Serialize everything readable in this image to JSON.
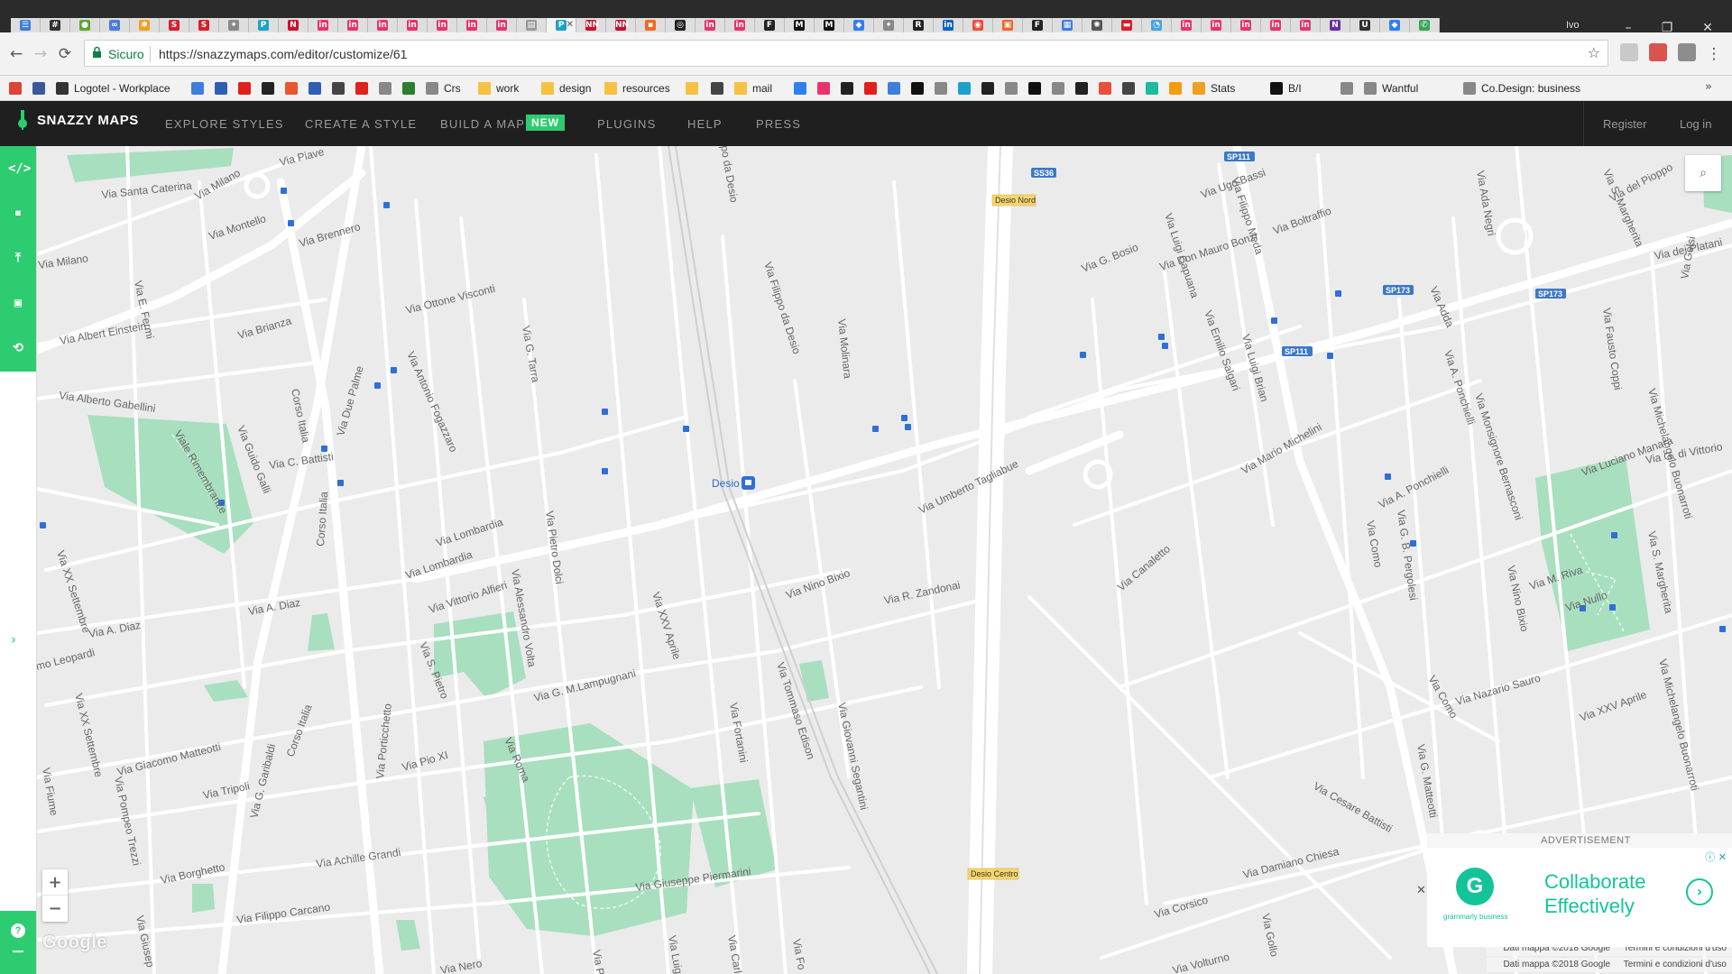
{
  "browser": {
    "tabs": [
      {
        "color": "#3d7fdb",
        "glyph": "☰"
      },
      {
        "color": "#333333",
        "glyph": "#"
      },
      {
        "color": "#5fa832",
        "glyph": "●"
      },
      {
        "color": "#4a7bd8",
        "glyph": "∞"
      },
      {
        "color": "#f0a020",
        "glyph": "✱"
      },
      {
        "color": "#d81e2b",
        "glyph": "S"
      },
      {
        "color": "#d81e2b",
        "glyph": "S"
      },
      {
        "color": "#888888",
        "glyph": "✦"
      },
      {
        "color": "#1ca2c9",
        "glyph": "P"
      },
      {
        "color": "#c8102e",
        "glyph": "N"
      },
      {
        "color": "#e8336d",
        "glyph": "in"
      },
      {
        "color": "#e8336d",
        "glyph": "in"
      },
      {
        "color": "#e8336d",
        "glyph": "in"
      },
      {
        "color": "#e8336d",
        "glyph": "in"
      },
      {
        "color": "#e8336d",
        "glyph": "in"
      },
      {
        "color": "#e8336d",
        "glyph": "in"
      },
      {
        "color": "#e8336d",
        "glyph": "in"
      },
      {
        "color": "#999999",
        "glyph": "▤"
      },
      {
        "color": "#1ca2c9",
        "glyph": "P"
      },
      {
        "color": "#c8102e",
        "glyph": "NN"
      },
      {
        "color": "#c8102e",
        "glyph": "NN"
      },
      {
        "color": "#f06a24",
        "glyph": "▪"
      },
      {
        "color": "#222222",
        "glyph": "◎"
      },
      {
        "color": "#e8336d",
        "glyph": "in"
      },
      {
        "color": "#e8336d",
        "glyph": "in"
      },
      {
        "color": "#222222",
        "glyph": "F"
      },
      {
        "color": "#111111",
        "glyph": "M"
      },
      {
        "color": "#111111",
        "glyph": "M"
      },
      {
        "color": "#2f80ed",
        "glyph": "◆"
      },
      {
        "color": "#888888",
        "glyph": "✦"
      },
      {
        "color": "#222222",
        "glyph": "R"
      },
      {
        "color": "#0a66c2",
        "glyph": "in"
      },
      {
        "color": "#e8503a",
        "glyph": "◉"
      },
      {
        "color": "#f26522",
        "glyph": "▣"
      },
      {
        "color": "#222222",
        "glyph": "F"
      },
      {
        "color": "#3d7fdb",
        "glyph": "▦"
      },
      {
        "color": "#555555",
        "glyph": "✺"
      },
      {
        "color": "#d81e2b",
        "glyph": "▬"
      },
      {
        "color": "#4aa3df",
        "glyph": "◔"
      },
      {
        "color": "#e8336d",
        "glyph": "in"
      },
      {
        "color": "#e8336d",
        "glyph": "in"
      },
      {
        "color": "#e8336d",
        "glyph": "in"
      },
      {
        "color": "#e8336d",
        "glyph": "in"
      },
      {
        "color": "#e8336d",
        "glyph": "in"
      },
      {
        "color": "#6b2fa0",
        "glyph": "N"
      },
      {
        "color": "#333333",
        "glyph": "U"
      },
      {
        "color": "#2f80ed",
        "glyph": "◆"
      },
      {
        "color": "#34a853",
        "glyph": "✆"
      }
    ],
    "active_tab_index": 18,
    "profile_label": "Ivo",
    "address": {
      "secure_label": "Sicuro",
      "url": "https://snazzymaps.com/editor/customize/61"
    },
    "bookmarks": [
      {
        "label": "",
        "icon_color": "#db4437"
      },
      {
        "label": "",
        "icon_color": "#3b5998"
      },
      {
        "label": "Logotel - Workplace",
        "icon_color": "#333333"
      },
      {
        "label": "",
        "icon_color": "#3d7fdb"
      },
      {
        "label": "",
        "icon_color": "#2f5fb3"
      },
      {
        "label": "",
        "icon_color": "#e0201b"
      },
      {
        "label": "",
        "icon_color": "#222222"
      },
      {
        "label": "",
        "icon_color": "#e8572d"
      },
      {
        "label": "",
        "icon_color": "#2f5fb3"
      },
      {
        "label": "",
        "icon_color": "#444444"
      },
      {
        "label": "",
        "icon_color": "#e0201b"
      },
      {
        "label": "",
        "icon_color": "#888888"
      },
      {
        "label": "",
        "icon_color": "#2e7d32"
      },
      {
        "label": "Crs",
        "icon_color": "#888888"
      },
      {
        "label": "work",
        "icon_color": "folder"
      },
      {
        "label": "design",
        "icon_color": "folder"
      },
      {
        "label": "resources",
        "icon_color": "folder"
      },
      {
        "label": "",
        "icon_color": "folder"
      },
      {
        "label": "",
        "icon_color": "#444444"
      },
      {
        "label": "mail",
        "icon_color": "folder"
      },
      {
        "label": "",
        "icon_color": "#2f80ed"
      },
      {
        "label": "",
        "icon_color": "#e8336d"
      },
      {
        "label": "",
        "icon_color": "#222222"
      },
      {
        "label": "",
        "icon_color": "#e0201b"
      },
      {
        "label": "",
        "icon_color": "#3d7fdb"
      },
      {
        "label": "",
        "icon_color": "#111111"
      },
      {
        "label": "",
        "icon_color": "#888888"
      },
      {
        "label": "",
        "icon_color": "#1ca2c9"
      },
      {
        "label": "",
        "icon_color": "#222222"
      },
      {
        "label": "",
        "icon_color": "#888888"
      },
      {
        "label": "",
        "icon_color": "#111111"
      },
      {
        "label": "",
        "icon_color": "#888888"
      },
      {
        "label": "",
        "icon_color": "#222222"
      },
      {
        "label": "",
        "icon_color": "#e8503a"
      },
      {
        "label": "",
        "icon_color": "#444444"
      },
      {
        "label": "",
        "icon_color": "#1abc9c"
      },
      {
        "label": "",
        "icon_color": "#f39c12"
      },
      {
        "label": "Stats",
        "icon_color": "#f0a020"
      },
      {
        "label": "B/I",
        "icon_color": "#111111"
      },
      {
        "label": "",
        "icon_color": "#888888"
      },
      {
        "label": "Wantful",
        "icon_color": "#888888"
      },
      {
        "label": "Co.Design: business",
        "icon_color": "#888888"
      }
    ],
    "bookmarks_more": "»"
  },
  "app": {
    "brand": "SNAZZY MAPS",
    "nav": [
      {
        "label": "EXPLORE STYLES"
      },
      {
        "label": "CREATE A STYLE"
      },
      {
        "label": "BUILD A MAP"
      },
      {
        "label": "PLUGINS"
      },
      {
        "label": "HELP"
      },
      {
        "label": "PRESS"
      }
    ],
    "new_badge": "NEW",
    "register": "Register",
    "login": "Log in",
    "accent": "#2ecc71",
    "rail_tools": [
      "</>",
      "▪",
      "⤒",
      "▣",
      "⟲"
    ]
  },
  "map": {
    "zoom_in": "+",
    "zoom_out": "−",
    "search_glyph": "⌕",
    "google_logo": "Google",
    "attribution_1": [
      "Dati mappa ©2018 Google",
      "Termini e condizioni d'uso"
    ],
    "attribution_2": [
      "Dati mappa ©2018 Google",
      "Termini e condizioni d'uso"
    ],
    "road_color": "#ffffff",
    "park_color": "#a8dfbf",
    "background_color": "#ebebeb",
    "labels": [
      {
        "text": "Via Piave"
      },
      {
        "text": "Via Santa Caterina"
      },
      {
        "text": "Via Milano"
      },
      {
        "text": "Via Montello"
      },
      {
        "text": "Via Brennero"
      },
      {
        "text": "Via E. Fermi"
      },
      {
        "text": "Corso Italia"
      },
      {
        "text": "Via Ottone Visconti"
      },
      {
        "text": "Via G. Tarra"
      },
      {
        "text": "Via Milano"
      },
      {
        "text": "Via Albert Einstein"
      },
      {
        "text": "Via Brianza"
      },
      {
        "text": "Via Antonio Fogazzaro"
      },
      {
        "text": "Via Due Palme"
      },
      {
        "text": "po da Desio"
      },
      {
        "text": "Via Filippo da Desio"
      },
      {
        "text": "Via Molinara"
      },
      {
        "text": "Via Alberto Gabellini"
      },
      {
        "text": "Viale Rimembranze"
      },
      {
        "text": "Via Guido Galli"
      },
      {
        "text": "Via C. Battisti"
      },
      {
        "text": "Corso Italia"
      },
      {
        "text": "Via Lombardia"
      },
      {
        "text": "Via Lombardia"
      },
      {
        "text": "Via Pietro Dolci"
      },
      {
        "text": "Via Alessandro Volta"
      },
      {
        "text": "Via XX Settembre"
      },
      {
        "text": "Via A. Diaz"
      },
      {
        "text": "Via A. Diaz"
      },
      {
        "text": "Via Vittorio Alfieri"
      },
      {
        "text": "Via XXV Aprile"
      },
      {
        "text": "Via Nino Bixio"
      },
      {
        "text": "Via Umberto Tagliabue"
      },
      {
        "text": "Via R. Zandonai"
      },
      {
        "text": "mo Leopardi"
      },
      {
        "text": "Via S. Pietro"
      },
      {
        "text": "Via XX Settembre"
      },
      {
        "text": "Corso Italia"
      },
      {
        "text": "Via G. M.Lampugnani"
      },
      {
        "text": "Via Tommaso Edison"
      },
      {
        "text": "Via Giovanni Segantini"
      },
      {
        "text": "Via Fortanini"
      },
      {
        "text": "Via Fiume"
      },
      {
        "text": "Via Giacomo Matteotti"
      },
      {
        "text": "Via Porticchetto"
      },
      {
        "text": "Via Pio XI"
      },
      {
        "text": "Via Roma"
      },
      {
        "text": "Via Pompeo Trezzi"
      },
      {
        "text": "Via Tripoli"
      },
      {
        "text": "Via G. Garibaldi"
      },
      {
        "text": "Via Borghetto"
      },
      {
        "text": "Via Achille Grandi"
      },
      {
        "text": "Via Giuseppe Piermarini"
      },
      {
        "text": "Via Filippo Carcano"
      },
      {
        "text": "Via Giusep"
      },
      {
        "text": "Via Ugo Bassi"
      },
      {
        "text": "Via Filippo Meda"
      },
      {
        "text": "Via Luigi Capuana"
      },
      {
        "text": "Via G. Bosio"
      },
      {
        "text": "Via Don Mauro Bonzi"
      },
      {
        "text": "Via Emilio Salgari"
      },
      {
        "text": "Via Luigi Brian"
      },
      {
        "text": "Via Boltraffio"
      },
      {
        "text": "Via Ada Negri"
      },
      {
        "text": "Via S. Margherita"
      },
      {
        "text": "Via del Pioppo"
      },
      {
        "text": "Via dei Platani"
      },
      {
        "text": "Via Gelsi"
      },
      {
        "text": "Via Adda"
      },
      {
        "text": "Via Fausto Coppi"
      },
      {
        "text": "Via A. Ponchielli"
      },
      {
        "text": "Via Monsignore Bernasconi"
      },
      {
        "text": "Via Michelangelo Buonarroti"
      },
      {
        "text": "Via G. di Vittorio"
      },
      {
        "text": "Via Luciano Manara"
      },
      {
        "text": "Via Mario Michelini"
      },
      {
        "text": "Via A. Ponchielli"
      },
      {
        "text": "Via G. B. Pergolesi"
      },
      {
        "text": "Via Como"
      },
      {
        "text": "Via Canaletto"
      },
      {
        "text": "Via S. Margherita"
      },
      {
        "text": "Via M. Riva"
      },
      {
        "text": "Via Nullo"
      },
      {
        "text": "Via Nino Bixio"
      },
      {
        "text": "Via Como"
      },
      {
        "text": "Via Nazario Sauro"
      },
      {
        "text": "Via XXV Aprile"
      },
      {
        "text": "Via G. Matteotti"
      },
      {
        "text": "Via Michelangelo Buonarroti"
      },
      {
        "text": "Via Cesare Battisti"
      },
      {
        "text": "Via Damiano Chiesa"
      },
      {
        "text": "Via Corsico"
      },
      {
        "text": "Via Gollo"
      },
      {
        "text": "Via Volturno"
      },
      {
        "text": "Via Nero"
      },
      {
        "text": "Via P."
      },
      {
        "text": "Via Luig"
      },
      {
        "text": "Via Carlo"
      },
      {
        "text": "Via Fo"
      }
    ],
    "shields": [
      {
        "text": "SS36"
      },
      {
        "text": "SP111"
      },
      {
        "text": "SP111"
      },
      {
        "text": "SP173"
      },
      {
        "text": "SP173"
      }
    ],
    "stations": [
      {
        "text": "Desio Nord"
      },
      {
        "text": "Desio Centro"
      }
    ],
    "poi": "Desio"
  },
  "ad": {
    "label": "ADVERTISEMENT",
    "headline": "Collaborate Effectively",
    "brand_letter": "G",
    "brand_word": "grammarly business",
    "cta": "›",
    "choices": "ⓘ ✕",
    "close": "✕"
  }
}
